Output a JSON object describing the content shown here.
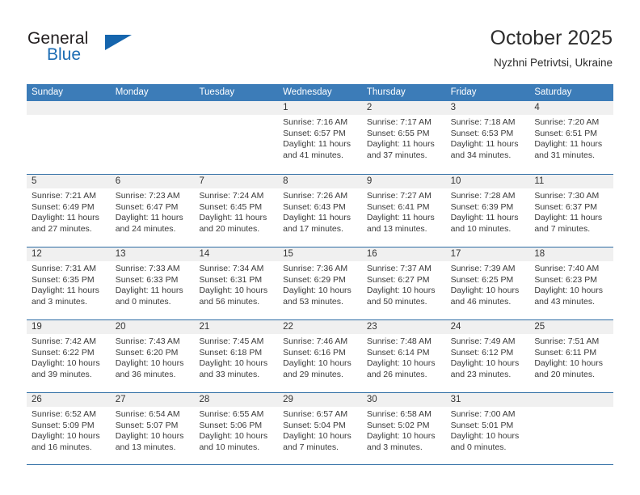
{
  "brand": {
    "name_part1": "General",
    "name_part2": "Blue",
    "accent_color": "#1565ad"
  },
  "header": {
    "title": "October 2025",
    "subtitle": "Nyzhni Petrivtsi, Ukraine"
  },
  "theme": {
    "header_band": "#3c7cb8",
    "row_divider": "#2e6da4",
    "day_band": "#f0f0f0",
    "text": "#3a3a3a"
  },
  "weekdays": [
    "Sunday",
    "Monday",
    "Tuesday",
    "Wednesday",
    "Thursday",
    "Friday",
    "Saturday"
  ],
  "labels": {
    "sunrise": "Sunrise:",
    "sunset": "Sunset:",
    "daylight": "Daylight:"
  },
  "weeks": [
    [
      {
        "day": "",
        "empty": true
      },
      {
        "day": "",
        "empty": true
      },
      {
        "day": "",
        "empty": true
      },
      {
        "day": "1",
        "sunrise": "Sunrise: 7:16 AM",
        "sunset": "Sunset: 6:57 PM",
        "daylight_1": "Daylight: 11 hours",
        "daylight_2": "and 41 minutes."
      },
      {
        "day": "2",
        "sunrise": "Sunrise: 7:17 AM",
        "sunset": "Sunset: 6:55 PM",
        "daylight_1": "Daylight: 11 hours",
        "daylight_2": "and 37 minutes."
      },
      {
        "day": "3",
        "sunrise": "Sunrise: 7:18 AM",
        "sunset": "Sunset: 6:53 PM",
        "daylight_1": "Daylight: 11 hours",
        "daylight_2": "and 34 minutes."
      },
      {
        "day": "4",
        "sunrise": "Sunrise: 7:20 AM",
        "sunset": "Sunset: 6:51 PM",
        "daylight_1": "Daylight: 11 hours",
        "daylight_2": "and 31 minutes."
      }
    ],
    [
      {
        "day": "5",
        "sunrise": "Sunrise: 7:21 AM",
        "sunset": "Sunset: 6:49 PM",
        "daylight_1": "Daylight: 11 hours",
        "daylight_2": "and 27 minutes."
      },
      {
        "day": "6",
        "sunrise": "Sunrise: 7:23 AM",
        "sunset": "Sunset: 6:47 PM",
        "daylight_1": "Daylight: 11 hours",
        "daylight_2": "and 24 minutes."
      },
      {
        "day": "7",
        "sunrise": "Sunrise: 7:24 AM",
        "sunset": "Sunset: 6:45 PM",
        "daylight_1": "Daylight: 11 hours",
        "daylight_2": "and 20 minutes."
      },
      {
        "day": "8",
        "sunrise": "Sunrise: 7:26 AM",
        "sunset": "Sunset: 6:43 PM",
        "daylight_1": "Daylight: 11 hours",
        "daylight_2": "and 17 minutes."
      },
      {
        "day": "9",
        "sunrise": "Sunrise: 7:27 AM",
        "sunset": "Sunset: 6:41 PM",
        "daylight_1": "Daylight: 11 hours",
        "daylight_2": "and 13 minutes."
      },
      {
        "day": "10",
        "sunrise": "Sunrise: 7:28 AM",
        "sunset": "Sunset: 6:39 PM",
        "daylight_1": "Daylight: 11 hours",
        "daylight_2": "and 10 minutes."
      },
      {
        "day": "11",
        "sunrise": "Sunrise: 7:30 AM",
        "sunset": "Sunset: 6:37 PM",
        "daylight_1": "Daylight: 11 hours",
        "daylight_2": "and 7 minutes."
      }
    ],
    [
      {
        "day": "12",
        "sunrise": "Sunrise: 7:31 AM",
        "sunset": "Sunset: 6:35 PM",
        "daylight_1": "Daylight: 11 hours",
        "daylight_2": "and 3 minutes."
      },
      {
        "day": "13",
        "sunrise": "Sunrise: 7:33 AM",
        "sunset": "Sunset: 6:33 PM",
        "daylight_1": "Daylight: 11 hours",
        "daylight_2": "and 0 minutes."
      },
      {
        "day": "14",
        "sunrise": "Sunrise: 7:34 AM",
        "sunset": "Sunset: 6:31 PM",
        "daylight_1": "Daylight: 10 hours",
        "daylight_2": "and 56 minutes."
      },
      {
        "day": "15",
        "sunrise": "Sunrise: 7:36 AM",
        "sunset": "Sunset: 6:29 PM",
        "daylight_1": "Daylight: 10 hours",
        "daylight_2": "and 53 minutes."
      },
      {
        "day": "16",
        "sunrise": "Sunrise: 7:37 AM",
        "sunset": "Sunset: 6:27 PM",
        "daylight_1": "Daylight: 10 hours",
        "daylight_2": "and 50 minutes."
      },
      {
        "day": "17",
        "sunrise": "Sunrise: 7:39 AM",
        "sunset": "Sunset: 6:25 PM",
        "daylight_1": "Daylight: 10 hours",
        "daylight_2": "and 46 minutes."
      },
      {
        "day": "18",
        "sunrise": "Sunrise: 7:40 AM",
        "sunset": "Sunset: 6:23 PM",
        "daylight_1": "Daylight: 10 hours",
        "daylight_2": "and 43 minutes."
      }
    ],
    [
      {
        "day": "19",
        "sunrise": "Sunrise: 7:42 AM",
        "sunset": "Sunset: 6:22 PM",
        "daylight_1": "Daylight: 10 hours",
        "daylight_2": "and 39 minutes."
      },
      {
        "day": "20",
        "sunrise": "Sunrise: 7:43 AM",
        "sunset": "Sunset: 6:20 PM",
        "daylight_1": "Daylight: 10 hours",
        "daylight_2": "and 36 minutes."
      },
      {
        "day": "21",
        "sunrise": "Sunrise: 7:45 AM",
        "sunset": "Sunset: 6:18 PM",
        "daylight_1": "Daylight: 10 hours",
        "daylight_2": "and 33 minutes."
      },
      {
        "day": "22",
        "sunrise": "Sunrise: 7:46 AM",
        "sunset": "Sunset: 6:16 PM",
        "daylight_1": "Daylight: 10 hours",
        "daylight_2": "and 29 minutes."
      },
      {
        "day": "23",
        "sunrise": "Sunrise: 7:48 AM",
        "sunset": "Sunset: 6:14 PM",
        "daylight_1": "Daylight: 10 hours",
        "daylight_2": "and 26 minutes."
      },
      {
        "day": "24",
        "sunrise": "Sunrise: 7:49 AM",
        "sunset": "Sunset: 6:12 PM",
        "daylight_1": "Daylight: 10 hours",
        "daylight_2": "and 23 minutes."
      },
      {
        "day": "25",
        "sunrise": "Sunrise: 7:51 AM",
        "sunset": "Sunset: 6:11 PM",
        "daylight_1": "Daylight: 10 hours",
        "daylight_2": "and 20 minutes."
      }
    ],
    [
      {
        "day": "26",
        "sunrise": "Sunrise: 6:52 AM",
        "sunset": "Sunset: 5:09 PM",
        "daylight_1": "Daylight: 10 hours",
        "daylight_2": "and 16 minutes."
      },
      {
        "day": "27",
        "sunrise": "Sunrise: 6:54 AM",
        "sunset": "Sunset: 5:07 PM",
        "daylight_1": "Daylight: 10 hours",
        "daylight_2": "and 13 minutes."
      },
      {
        "day": "28",
        "sunrise": "Sunrise: 6:55 AM",
        "sunset": "Sunset: 5:06 PM",
        "daylight_1": "Daylight: 10 hours",
        "daylight_2": "and 10 minutes."
      },
      {
        "day": "29",
        "sunrise": "Sunrise: 6:57 AM",
        "sunset": "Sunset: 5:04 PM",
        "daylight_1": "Daylight: 10 hours",
        "daylight_2": "and 7 minutes."
      },
      {
        "day": "30",
        "sunrise": "Sunrise: 6:58 AM",
        "sunset": "Sunset: 5:02 PM",
        "daylight_1": "Daylight: 10 hours",
        "daylight_2": "and 3 minutes."
      },
      {
        "day": "31",
        "sunrise": "Sunrise: 7:00 AM",
        "sunset": "Sunset: 5:01 PM",
        "daylight_1": "Daylight: 10 hours",
        "daylight_2": "and 0 minutes."
      },
      {
        "day": "",
        "empty": true
      }
    ]
  ]
}
